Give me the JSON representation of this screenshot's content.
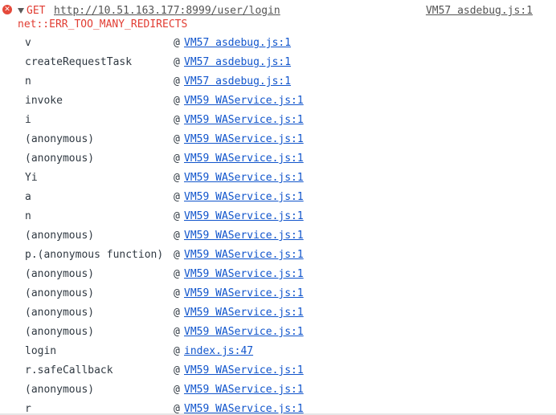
{
  "error": {
    "method": "GET",
    "url": "http://10.51.163.177:8999/user/login",
    "source": "VM57 asdebug.js:1",
    "message": "net::ERR_TOO_MANY_REDIRECTS",
    "icon": "error-circle-icon",
    "icon_glyph": "✕"
  },
  "stack": [
    {
      "fn": "v",
      "loc": "VM57 asdebug.js:1"
    },
    {
      "fn": "createRequestTask",
      "loc": "VM57 asdebug.js:1"
    },
    {
      "fn": "n",
      "loc": "VM57 asdebug.js:1"
    },
    {
      "fn": "invoke",
      "loc": "VM59 WAService.js:1"
    },
    {
      "fn": "i",
      "loc": "VM59 WAService.js:1"
    },
    {
      "fn": "(anonymous)",
      "loc": "VM59 WAService.js:1"
    },
    {
      "fn": "(anonymous)",
      "loc": "VM59 WAService.js:1"
    },
    {
      "fn": "Yi",
      "loc": "VM59 WAService.js:1"
    },
    {
      "fn": "a",
      "loc": "VM59 WAService.js:1"
    },
    {
      "fn": "n",
      "loc": "VM59 WAService.js:1"
    },
    {
      "fn": "(anonymous)",
      "loc": "VM59 WAService.js:1"
    },
    {
      "fn": "p.(anonymous function)",
      "loc": "VM59 WAService.js:1"
    },
    {
      "fn": "(anonymous)",
      "loc": "VM59 WAService.js:1"
    },
    {
      "fn": "(anonymous)",
      "loc": "VM59 WAService.js:1"
    },
    {
      "fn": "(anonymous)",
      "loc": "VM59 WAService.js:1"
    },
    {
      "fn": "(anonymous)",
      "loc": "VM59 WAService.js:1"
    },
    {
      "fn": "login",
      "loc": "index.js:47"
    },
    {
      "fn": "r.safeCallback",
      "loc": "VM59 WAService.js:1"
    },
    {
      "fn": "(anonymous)",
      "loc": "VM59 WAService.js:1"
    },
    {
      "fn": "r",
      "loc": "VM59 WAService.js:1"
    }
  ],
  "at_symbol": "@"
}
